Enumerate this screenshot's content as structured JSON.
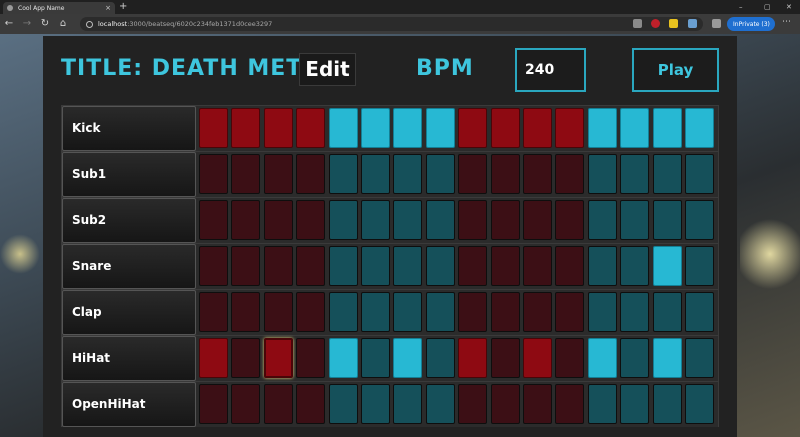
{
  "browser": {
    "tab_title": "Cool App Name",
    "tab_close": "×",
    "new_tab": "+",
    "url_host": "localhost",
    "url_path": ":3000/beatseq/6020c234feb1371d0cee3297",
    "private_label": "InPrivate (3)",
    "more_icon": "⋯",
    "minimize": "–",
    "maximize": "▢",
    "close": "✕",
    "back": "←",
    "forward": "→",
    "reload": "↻",
    "home": "⌂"
  },
  "header": {
    "title": "TITLE: DEATH METAL",
    "edit_label": "Edit",
    "bpm_label": "BPM",
    "bpm_value": "240",
    "play_label": "Play"
  },
  "colors": {
    "accent": "#3ec6de",
    "step_red_on": "#8e0a12",
    "step_red_off": "#3c0f15",
    "step_blue_on": "#27b8d3",
    "step_blue_off": "#15505a",
    "selected_outline": "#e8d37a"
  },
  "tracks": [
    {
      "name": "Kick",
      "steps": [
        1,
        1,
        1,
        1,
        1,
        1,
        1,
        1,
        1,
        1,
        1,
        1,
        1,
        1,
        1,
        1
      ]
    },
    {
      "name": "Sub1",
      "steps": [
        0,
        0,
        0,
        0,
        0,
        0,
        0,
        0,
        0,
        0,
        0,
        0,
        0,
        0,
        0,
        0
      ]
    },
    {
      "name": "Sub2",
      "steps": [
        0,
        0,
        0,
        0,
        0,
        0,
        0,
        0,
        0,
        0,
        0,
        0,
        0,
        0,
        0,
        0
      ]
    },
    {
      "name": "Snare",
      "steps": [
        0,
        0,
        0,
        0,
        0,
        0,
        0,
        0,
        0,
        0,
        0,
        0,
        0,
        0,
        1,
        0
      ]
    },
    {
      "name": "Clap",
      "steps": [
        0,
        0,
        0,
        0,
        0,
        0,
        0,
        0,
        0,
        0,
        0,
        0,
        0,
        0,
        0,
        0
      ]
    },
    {
      "name": "HiHat",
      "steps": [
        1,
        0,
        1,
        0,
        1,
        0,
        1,
        0,
        1,
        0,
        1,
        0,
        1,
        0,
        1,
        0
      ]
    },
    {
      "name": "OpenHiHat",
      "steps": [
        0,
        0,
        0,
        0,
        0,
        0,
        0,
        0,
        0,
        0,
        0,
        0,
        0,
        0,
        0,
        0
      ]
    }
  ],
  "selected_step": {
    "track": 5,
    "step": 2
  }
}
